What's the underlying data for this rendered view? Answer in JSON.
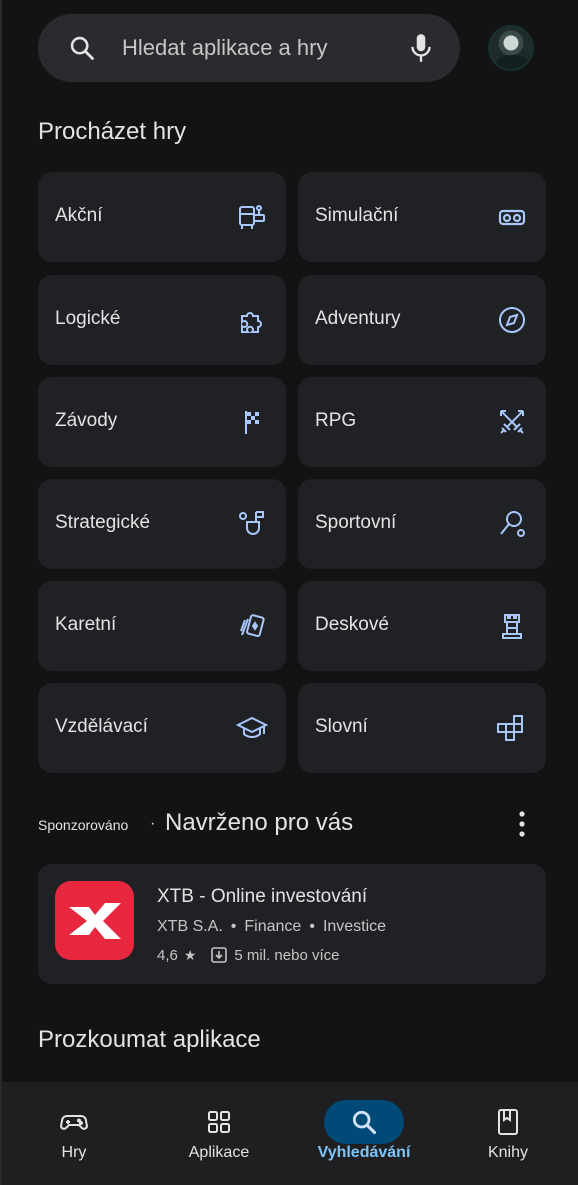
{
  "search": {
    "placeholder": "Hledat aplikace a hry"
  },
  "browse": {
    "title": "Procházet hry",
    "categories": [
      {
        "label": "Akční",
        "icon": "arcade-icon"
      },
      {
        "label": "Simulační",
        "icon": "vr-headset-icon"
      },
      {
        "label": "Logické",
        "icon": "puzzle-icon"
      },
      {
        "label": "Adventury",
        "icon": "compass-icon"
      },
      {
        "label": "Závody",
        "icon": "checkered-flag-icon"
      },
      {
        "label": "RPG",
        "icon": "crossed-swords-icon"
      },
      {
        "label": "Strategické",
        "icon": "strategy-icon"
      },
      {
        "label": "Sportovní",
        "icon": "racket-icon"
      },
      {
        "label": "Karetní",
        "icon": "cards-icon"
      },
      {
        "label": "Deskové",
        "icon": "rook-icon"
      },
      {
        "label": "Vzdělávací",
        "icon": "graduation-cap-icon"
      },
      {
        "label": "Slovní",
        "icon": "word-tiles-icon"
      }
    ]
  },
  "sponsored": {
    "label": "Sponzorováno",
    "separator": "·",
    "title": "Navrženo pro vás",
    "app": {
      "name": "XTB - Online investování",
      "developer": "XTB S.A.",
      "category": "Finance",
      "subcategory": "Investice",
      "rating": "4,6",
      "installs": "5 mil. nebo více",
      "icon_color": "#e7273e"
    }
  },
  "explore": {
    "title": "Prozkoumat aplikace"
  },
  "nav": {
    "items": [
      {
        "label": "Hry",
        "icon": "gamepad-icon"
      },
      {
        "label": "Aplikace",
        "icon": "apps-grid-icon"
      },
      {
        "label": "Vyhledávání",
        "icon": "search-icon",
        "active": true
      },
      {
        "label": "Knihy",
        "icon": "book-icon"
      }
    ]
  },
  "colors": {
    "accent_icon": "#a8c7fa",
    "active_nav_bg": "#004a77",
    "active_nav_text": "#7cc4fa"
  }
}
